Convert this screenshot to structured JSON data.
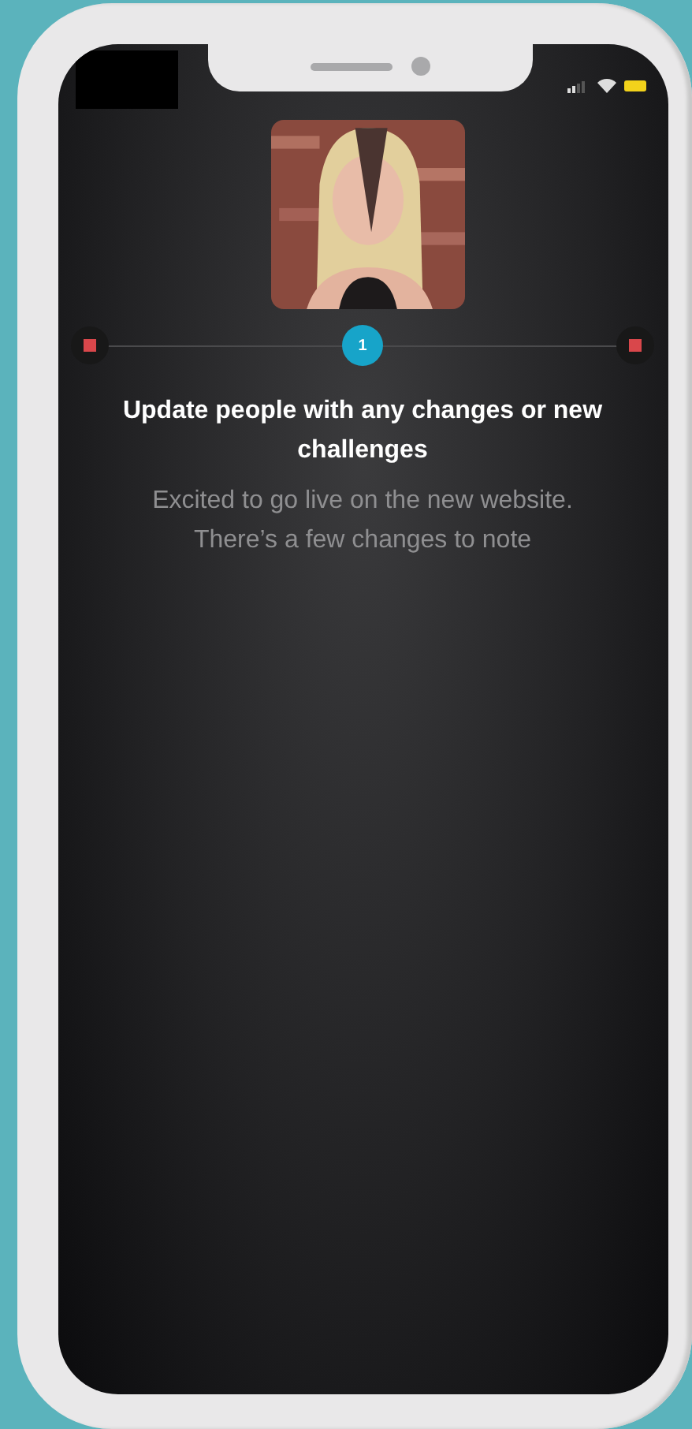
{
  "status_bar": {
    "kind": "phone"
  },
  "steps": [
    {
      "kind": "square",
      "selected": false
    },
    {
      "kind": "number",
      "label": "1",
      "selected": true
    },
    {
      "kind": "square",
      "selected": false
    }
  ],
  "title": "Update people with any changes or new challenges",
  "description": "Excited to go live on the new website. There’s a few changes to note"
}
